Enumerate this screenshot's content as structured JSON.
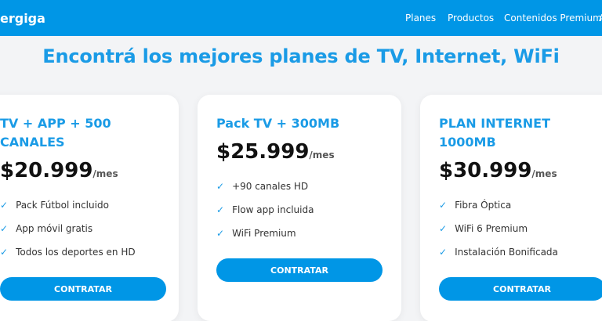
{
  "header": {
    "brand": "ergiga",
    "nav": [
      "Planes",
      "Productos",
      "Contenidos Premium",
      "A"
    ]
  },
  "headline": "Encontrá los mejores planes de TV, Internet, WiFi",
  "cards": [
    {
      "title_lines": [
        "TV + APP + 500",
        "CANALES"
      ],
      "price": "$20.999",
      "unit": "/mes",
      "features": [
        "Pack Fútbol incluido",
        "App móvil gratis",
        "Todos los deportes en HD"
      ],
      "button": "CONTRATAR"
    },
    {
      "title_lines": [
        "Pack TV + 300MB"
      ],
      "price": "$25.999",
      "unit": "/mes",
      "features": [
        "+90 canales HD",
        "Flow app incluida",
        "WiFi Premium"
      ],
      "button": "CONTRATAR"
    },
    {
      "title_lines": [
        "PLAN INTERNET",
        "1000MB"
      ],
      "price": "$30.999",
      "unit": "/mes",
      "features": [
        "Fibra Óptica",
        "WiFi 6 Premium",
        "Instalación Bonificada"
      ],
      "button": "CONTRATAR"
    }
  ],
  "check_glyph": "✓",
  "colors": {
    "header_bg": "#0096e6",
    "accent": "#1a9be6",
    "button": "#0096e6",
    "page_bg": "#f3f4f6"
  }
}
